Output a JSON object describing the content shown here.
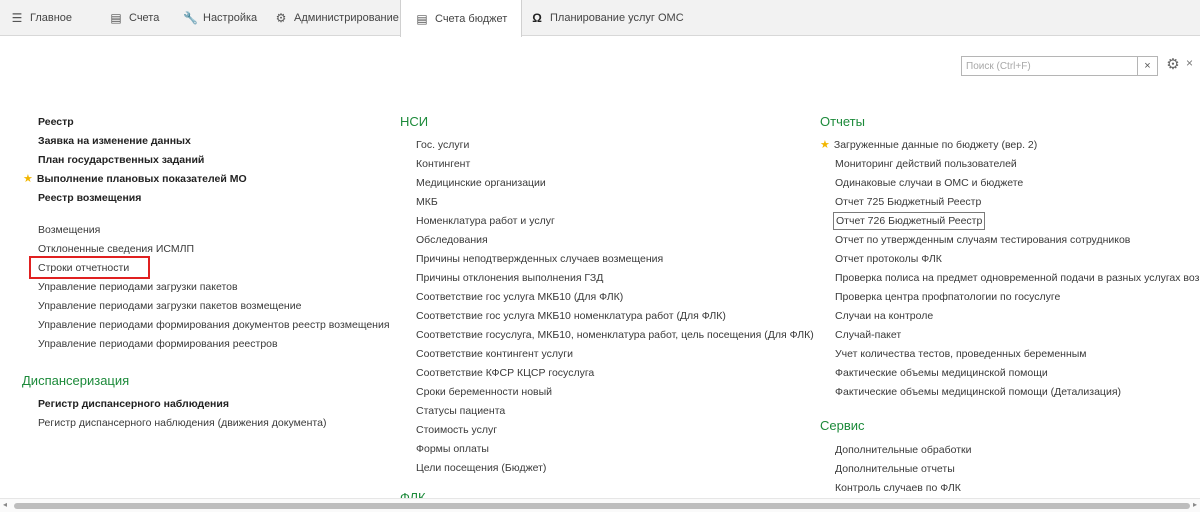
{
  "tabs": [
    {
      "label": "Главное",
      "icon": "menu-icon"
    },
    {
      "label": "Счета",
      "icon": "document-icon"
    },
    {
      "label": "Настройка",
      "icon": "wrench-icon"
    },
    {
      "label": "Администрирование",
      "icon": "gear-icon"
    },
    {
      "label": "Счета бюджет",
      "icon": "document-icon"
    },
    {
      "label": "Планирование услуг ОМС",
      "icon": "omega-icon"
    }
  ],
  "search": {
    "placeholder": "Поиск (Ctrl+F)",
    "value": ""
  },
  "left": {
    "main_items": [
      "Реестр",
      "Заявка на изменение данных",
      "План государственных заданий",
      "Выполнение плановых показателей МО",
      "Реестр возмещения"
    ],
    "items": [
      "Возмещения",
      "Отклоненные сведения ИСМЛП",
      "Строки отчетности",
      "Управление периодами загрузки пакетов",
      "Управление периодами загрузки пакетов возмещение",
      "Управление периодами формирования документов реестр возмещения",
      "Управление периодами формирования реестров"
    ],
    "section2_title": "Диспансеризация",
    "section2_items": [
      "Регистр диспансерного наблюдения",
      "Регистр диспансерного наблюдения (движения документа)"
    ]
  },
  "middle": {
    "title": "НСИ",
    "items": [
      "Гос. услуги",
      "Контингент",
      "Медицинские организации",
      "МКБ",
      "Номенклатура работ и услуг",
      "Обследования",
      "Причины неподтвержденных случаев возмещения",
      "Причины отклонения выполнения ГЗД",
      "Соответствие гос услуга МКБ10 (Для ФЛК)",
      "Соответствие гос услуга МКБ10 номенклатура работ (Для ФЛК)",
      "Соответствие госуслуга, МКБ10, номенклатура работ, цель посещения (Для ФЛК)",
      "Соответствие контингент услуги",
      "Соответствие КФСР КЦСР госуслуга",
      "Сроки беременности новый",
      "Статусы пациента",
      "Стоимость услуг",
      "Формы оплаты",
      "Цели посещения (Бюджет)"
    ],
    "next_title": "ФЛК"
  },
  "right": {
    "title": "Отчеты",
    "items": [
      "Загруженные данные по бюджету (вер. 2)",
      "Мониторинг действий пользователей",
      "Одинаковые случаи в ОМС и бюджете",
      "Отчет 725 Бюджетный Реестр",
      "Отчет 726 Бюджетный Реестр",
      "Отчет по утвержденным случаям тестирования сотрудников",
      "Отчет протоколы ФЛК",
      "Проверка полиса на предмет одновременной подачи в разных услугах возмеще",
      "Проверка центра профпатологии по госуслуге",
      "Случаи на контроле",
      "Случай-пакет",
      "Учет количества тестов, проведенных беременным",
      "Фактические объемы медицинской помощи",
      "Фактические объемы медицинской помощи (Детализация)"
    ],
    "section2_title": "Сервис",
    "section2_items": [
      "Дополнительные обработки",
      "Дополнительные отчеты",
      "Контроль случаев по ФЛК"
    ]
  },
  "colors": {
    "section_heading": "#1c8a3a",
    "highlight_box": "#e02020",
    "star": "#f2b600"
  }
}
